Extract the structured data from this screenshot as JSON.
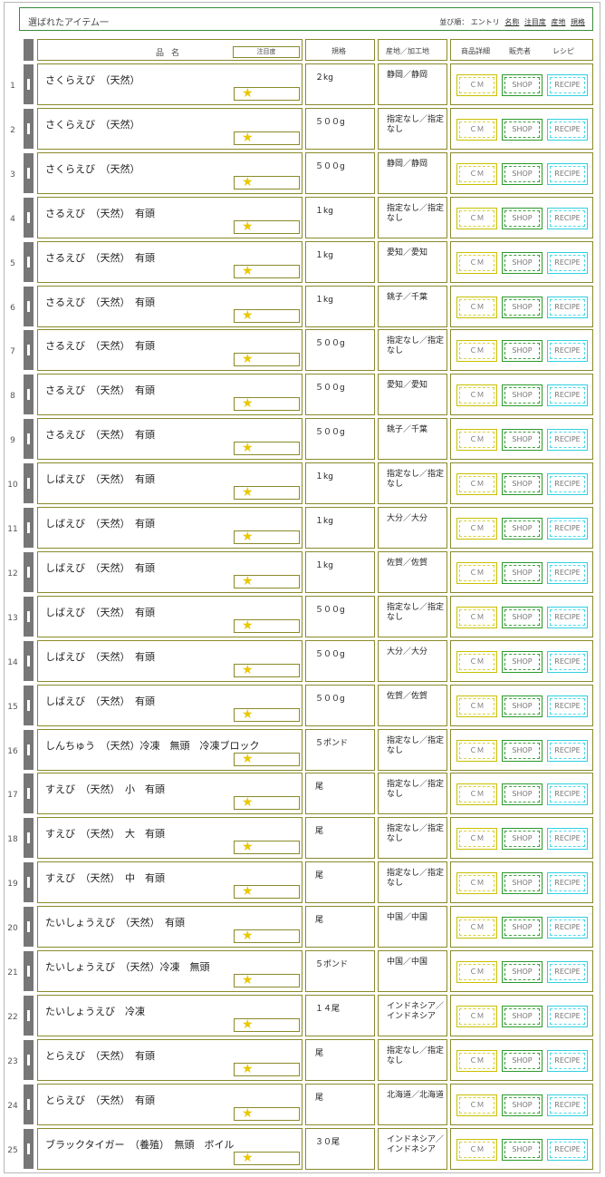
{
  "header": {
    "title": "選ばれたアイテム一",
    "sort_prefix": "並び順：",
    "sort_options": [
      "エントリ",
      "名称",
      "注目度",
      "産地",
      "規格"
    ]
  },
  "columns": {
    "name": "品名",
    "attention": "注目度",
    "spec": "規格",
    "origin": "産地／加工地",
    "detail": "商品詳細",
    "seller": "販売者",
    "recipe": "レシピ"
  },
  "buttons": {
    "cm": "ＣＭ",
    "shop": "SHOP",
    "recipe": "RECIPE"
  },
  "star": "★",
  "rows": [
    {
      "num": "1",
      "name": "さくらえび　（天然）",
      "spec": "２kg",
      "origin": "静岡／静岡"
    },
    {
      "num": "2",
      "name": "さくらえび　（天然）",
      "spec": "５００g",
      "origin": "指定なし／指定なし"
    },
    {
      "num": "3",
      "name": "さくらえび　（天然）",
      "spec": "５００g",
      "origin": "静岡／静岡"
    },
    {
      "num": "4",
      "name": "さるえび　（天然）　有頭",
      "spec": "１kg",
      "origin": "指定なし／指定なし"
    },
    {
      "num": "5",
      "name": "さるえび　（天然）　有頭",
      "spec": "１kg",
      "origin": "愛知／愛知"
    },
    {
      "num": "6",
      "name": "さるえび　（天然）　有頭",
      "spec": "１kg",
      "origin": "銚子／千葉"
    },
    {
      "num": "7",
      "name": "さるえび　（天然）　有頭",
      "spec": "５００g",
      "origin": "指定なし／指定なし"
    },
    {
      "num": "8",
      "name": "さるえび　（天然）　有頭",
      "spec": "５００g",
      "origin": "愛知／愛知"
    },
    {
      "num": "9",
      "name": "さるえび　（天然）　有頭",
      "spec": "５００g",
      "origin": "銚子／千葉"
    },
    {
      "num": "10",
      "name": "しばえび　（天然）　有頭",
      "spec": "１kg",
      "origin": "指定なし／指定なし"
    },
    {
      "num": "11",
      "name": "しばえび　（天然）　有頭",
      "spec": "１kg",
      "origin": "大分／大分"
    },
    {
      "num": "12",
      "name": "しばえび　（天然）　有頭",
      "spec": "１kg",
      "origin": "佐賀／佐賀"
    },
    {
      "num": "13",
      "name": "しばえび　（天然）　有頭",
      "spec": "５００g",
      "origin": "指定なし／指定なし"
    },
    {
      "num": "14",
      "name": "しばえび　（天然）　有頭",
      "spec": "５００g",
      "origin": "大分／大分"
    },
    {
      "num": "15",
      "name": "しばえび　（天然）　有頭",
      "spec": "５００g",
      "origin": "佐賀／佐賀"
    },
    {
      "num": "16",
      "name": "しんちゅう　（天然）冷凍　無頭　冷凍ブロック",
      "spec": "５ポンド",
      "origin": "指定なし／指定なし"
    },
    {
      "num": "17",
      "name": "すえび　（天然）　小　有頭",
      "spec": "尾",
      "origin": "指定なし／指定なし"
    },
    {
      "num": "18",
      "name": "すえび　（天然）　大　有頭",
      "spec": "尾",
      "origin": "指定なし／指定なし"
    },
    {
      "num": "19",
      "name": "すえび　（天然）　中　有頭",
      "spec": "尾",
      "origin": "指定なし／指定なし"
    },
    {
      "num": "20",
      "name": "たいしょうえび　（天然）　有頭",
      "spec": "尾",
      "origin": "中国／中国"
    },
    {
      "num": "21",
      "name": "たいしょうえび　（天然）冷凍　無頭",
      "spec": "５ポンド",
      "origin": "中国／中国"
    },
    {
      "num": "22",
      "name": "たいしょうえび　冷凍",
      "spec": "１４尾",
      "origin": "インドネシア／インドネシア"
    },
    {
      "num": "23",
      "name": "とらえび　（天然）　有頭",
      "spec": "尾",
      "origin": "指定なし／指定なし"
    },
    {
      "num": "24",
      "name": "とらえび　（天然）　有頭",
      "spec": "尾",
      "origin": "北海道／北海道"
    },
    {
      "num": "25",
      "name": "ブラックタイガー　（養殖）　無頭　ボイル",
      "spec": "３０尾",
      "origin": "インドネシア／インドネシア"
    }
  ]
}
